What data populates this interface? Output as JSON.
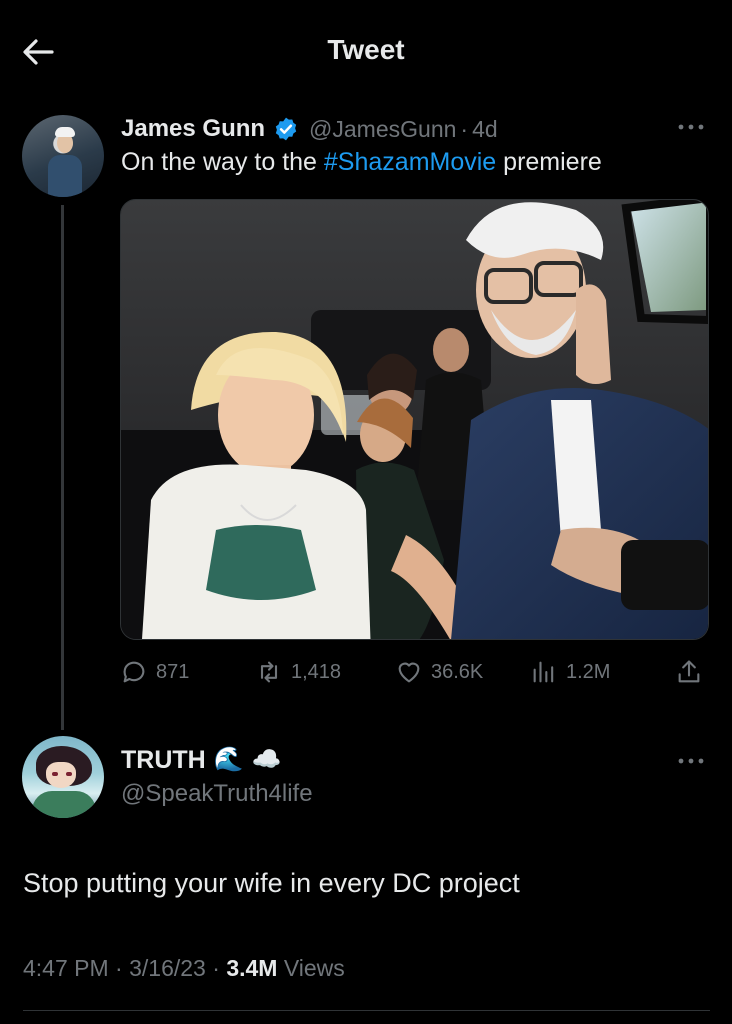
{
  "header": {
    "title": "Tweet",
    "back_icon": "arrow-left-icon"
  },
  "tweet": {
    "author_name": "James Gunn",
    "verified_icon": "verified-badge-icon",
    "verified_color": "#1d9bf0",
    "handle": "@JamesGunn",
    "separator": "·",
    "age": "4d",
    "text_before": "On the way to the ",
    "hashtag": "#ShazamMovie",
    "text_after": " premiere",
    "hashtag_color": "#1d9bf0",
    "stats": {
      "replies": "871",
      "retweets": "1,418",
      "likes": "36.6K",
      "views": "1.2M"
    }
  },
  "reply": {
    "author_name": "TRUTH",
    "name_emoji_1": "🌊",
    "name_emoji_2": "☁️",
    "handle": "@SpeakTruth4life",
    "text": "Stop putting your wife in every DC project",
    "meta_time": "4:47 PM",
    "meta_sep": " · ",
    "meta_date": "3/16/23",
    "meta_views_count": "3.4M",
    "meta_views_label": " Views"
  },
  "colors": {
    "background": "#000000",
    "text_primary": "#e7e9ea",
    "text_secondary": "#71767b",
    "accent": "#1d9bf0"
  }
}
